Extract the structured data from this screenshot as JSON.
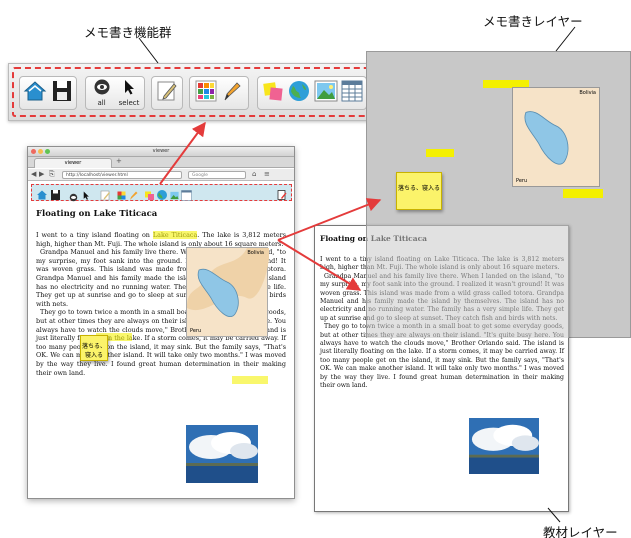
{
  "labels": {
    "memo_tools": "メモ書き機能群",
    "memo_layer": "メモ書きレイヤー",
    "material_layer": "教材レイヤー"
  },
  "toolbar": {
    "all_label": "all",
    "select_label": "select",
    "icons": [
      "home-icon",
      "save-icon",
      "eye-all-icon",
      "select-arrow-icon",
      "pencil-icon",
      "color-palette-icon",
      "brush-icon",
      "sticky-notes-icon",
      "web-globe-icon",
      "image-icon",
      "table-icon",
      "edit-note-icon"
    ]
  },
  "browser": {
    "window_title": "viewer",
    "tab_label": "viewer",
    "url": "http://localhost/viewer.html",
    "search_placeholder": "Google"
  },
  "document": {
    "title": "Floating on Lake Titicaca",
    "map_label_bolivia": "Bolivia",
    "map_label_peru": "Peru",
    "sticky_note": "落ちる、寝入る",
    "paragraphs": [
      "I went to a tiny island floating on Lake Titicaca. The lake is 3,812 meters high, higher than Mt. Fuji. The whole island is only about 16 square meters.",
      "Grandpa Manuel and his family live there. When I landed on the island, \"to my surprise, my foot sank into the ground. I realized it wasn't ground! It was woven grass. This island was made from a wild grass called totora. Grandpa Manuel and his family made the island by themselves. The island has no electricity and no running water. The family has a very simple life. They get up at sunrise and go to sleep at sunset. They catch fish and birds with nets.",
      "They go to town twice a month in a small boat to get some everyday goods, but at other times they are always on their island. \"It's quite busy here. You always have to watch the clouds move,\" Brother Orlando said. The island is just literally floating on the lake. If a storm comes, it may be carried away. If too many people get on the island, it may sink. But the family says, \"That's OK. We can make another island. It will take only two months.\" I was moved by the way they live. I found great human determination in their making their own land."
    ],
    "highlights": [
      "Lake Titicaca",
      "go to sleep",
      "carried away"
    ]
  },
  "colors": {
    "dash_red": "#e43b3b",
    "highlight_yellow": "#f5f20a",
    "sticky_yellow": "#fbf36a",
    "toolbar_teal": "#cfe7ef",
    "memo_layer_gray": "#c8c8c8"
  }
}
